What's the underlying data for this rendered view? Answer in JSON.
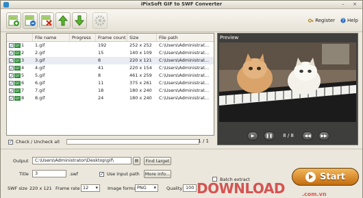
{
  "app": {
    "title": "iPixSoft GIF to SWF Converter"
  },
  "toolbar": {
    "register": "Register",
    "help": "Help"
  },
  "file_list": {
    "headers": {
      "file_name": "File name",
      "progress": "Progress",
      "frame_count": "Frame count",
      "size": "Size",
      "file_path": "File path"
    },
    "rows": [
      {
        "index": "1",
        "file_name": "1.gif",
        "progress": "",
        "frame_count": "192",
        "size": "252 x 252",
        "file_path": "C:\\Users\\Administrat..."
      },
      {
        "index": "2",
        "file_name": "2.gif",
        "progress": "",
        "frame_count": "15",
        "size": "140 x 109",
        "file_path": "C:\\Users\\Administrat..."
      },
      {
        "index": "3",
        "file_name": "3.gif",
        "progress": "",
        "frame_count": "8",
        "size": "220 x 121",
        "file_path": "C:\\Users\\Administrat..."
      },
      {
        "index": "4",
        "file_name": "4.gif",
        "progress": "",
        "frame_count": "41",
        "size": "220 x 154",
        "file_path": "C:\\Users\\Administrat..."
      },
      {
        "index": "5",
        "file_name": "5.gif",
        "progress": "",
        "frame_count": "8",
        "size": "461 x 259",
        "file_path": "C:\\Users\\Administrat..."
      },
      {
        "index": "6",
        "file_name": "6.gif",
        "progress": "",
        "frame_count": "11",
        "size": "375 x 261",
        "file_path": "C:\\Users\\Administrat..."
      },
      {
        "index": "7",
        "file_name": "7.gif",
        "progress": "",
        "frame_count": "18",
        "size": "180 x 240",
        "file_path": "C:\\Users\\Administrat..."
      },
      {
        "index": "8",
        "file_name": "8.gif",
        "progress": "",
        "frame_count": "24",
        "size": "180 x 240",
        "file_path": "C:\\Users\\Administrat..."
      }
    ],
    "check_all_label": "Check / Uncheck all",
    "page_count": "1 / 1"
  },
  "preview": {
    "label": "Preview",
    "frame_counter": "8 / 8"
  },
  "settings": {
    "output_label": "Output",
    "output_value": "C:\\Users\\Administrator\\Desktop\\gif\\",
    "find_target": "Find target",
    "title_label": "Title",
    "title_value": "3",
    "title_ext": ".swf",
    "use_input_path": "Use input path",
    "more_info": "More info...",
    "batch_extract": "Batch extract",
    "swf_size_label": "SWF size",
    "swf_size_value": "220 x 121",
    "frame_rate_label": "Frame rate",
    "frame_rate_value": "12",
    "image_format_label": "Image format",
    "image_format_value": "PNG",
    "quality_label": "Quality",
    "quality_value": "100"
  },
  "start_button": {
    "label": "Start"
  },
  "watermark": {
    "brand": "DOWNLOAD",
    "sub": ".com.vn"
  }
}
